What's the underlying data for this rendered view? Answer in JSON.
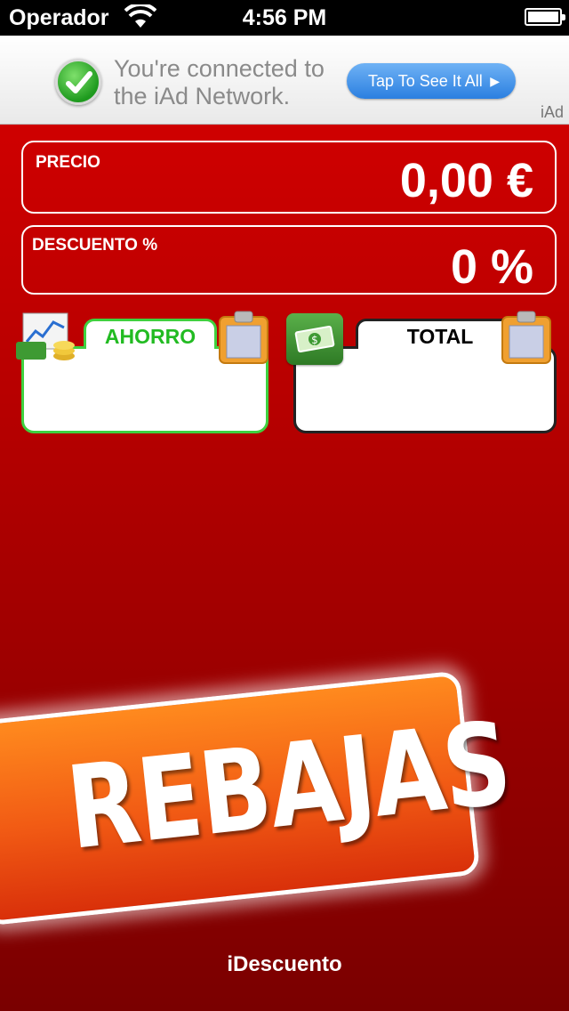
{
  "status_bar": {
    "carrier": "Operador",
    "time": "4:56 PM"
  },
  "ad_banner": {
    "message": "You're connected to the iAd Network.",
    "button_label": "Tap To See It All",
    "logo_text": "iAd"
  },
  "fields": {
    "precio": {
      "label": "PRECIO",
      "value": "0,00 €"
    },
    "descuento": {
      "label": "DESCUENTO %",
      "value": "0 %"
    }
  },
  "results": {
    "ahorro": {
      "label": "AHORRO",
      "value": ""
    },
    "total": {
      "label": "TOTAL",
      "value": ""
    }
  },
  "banner": {
    "text": "REBAJAS"
  },
  "footer": {
    "app_name": "iDescuento"
  },
  "icons": [
    "wifi-icon",
    "battery-icon",
    "checkmark-icon",
    "chevron-right-icon",
    "chart-coins-icon",
    "money-icon",
    "clipboard-icon"
  ],
  "colors": {
    "background_red": "#cf0000",
    "ahorro_green": "#22bb22",
    "banner_orange": "#f15a14"
  }
}
